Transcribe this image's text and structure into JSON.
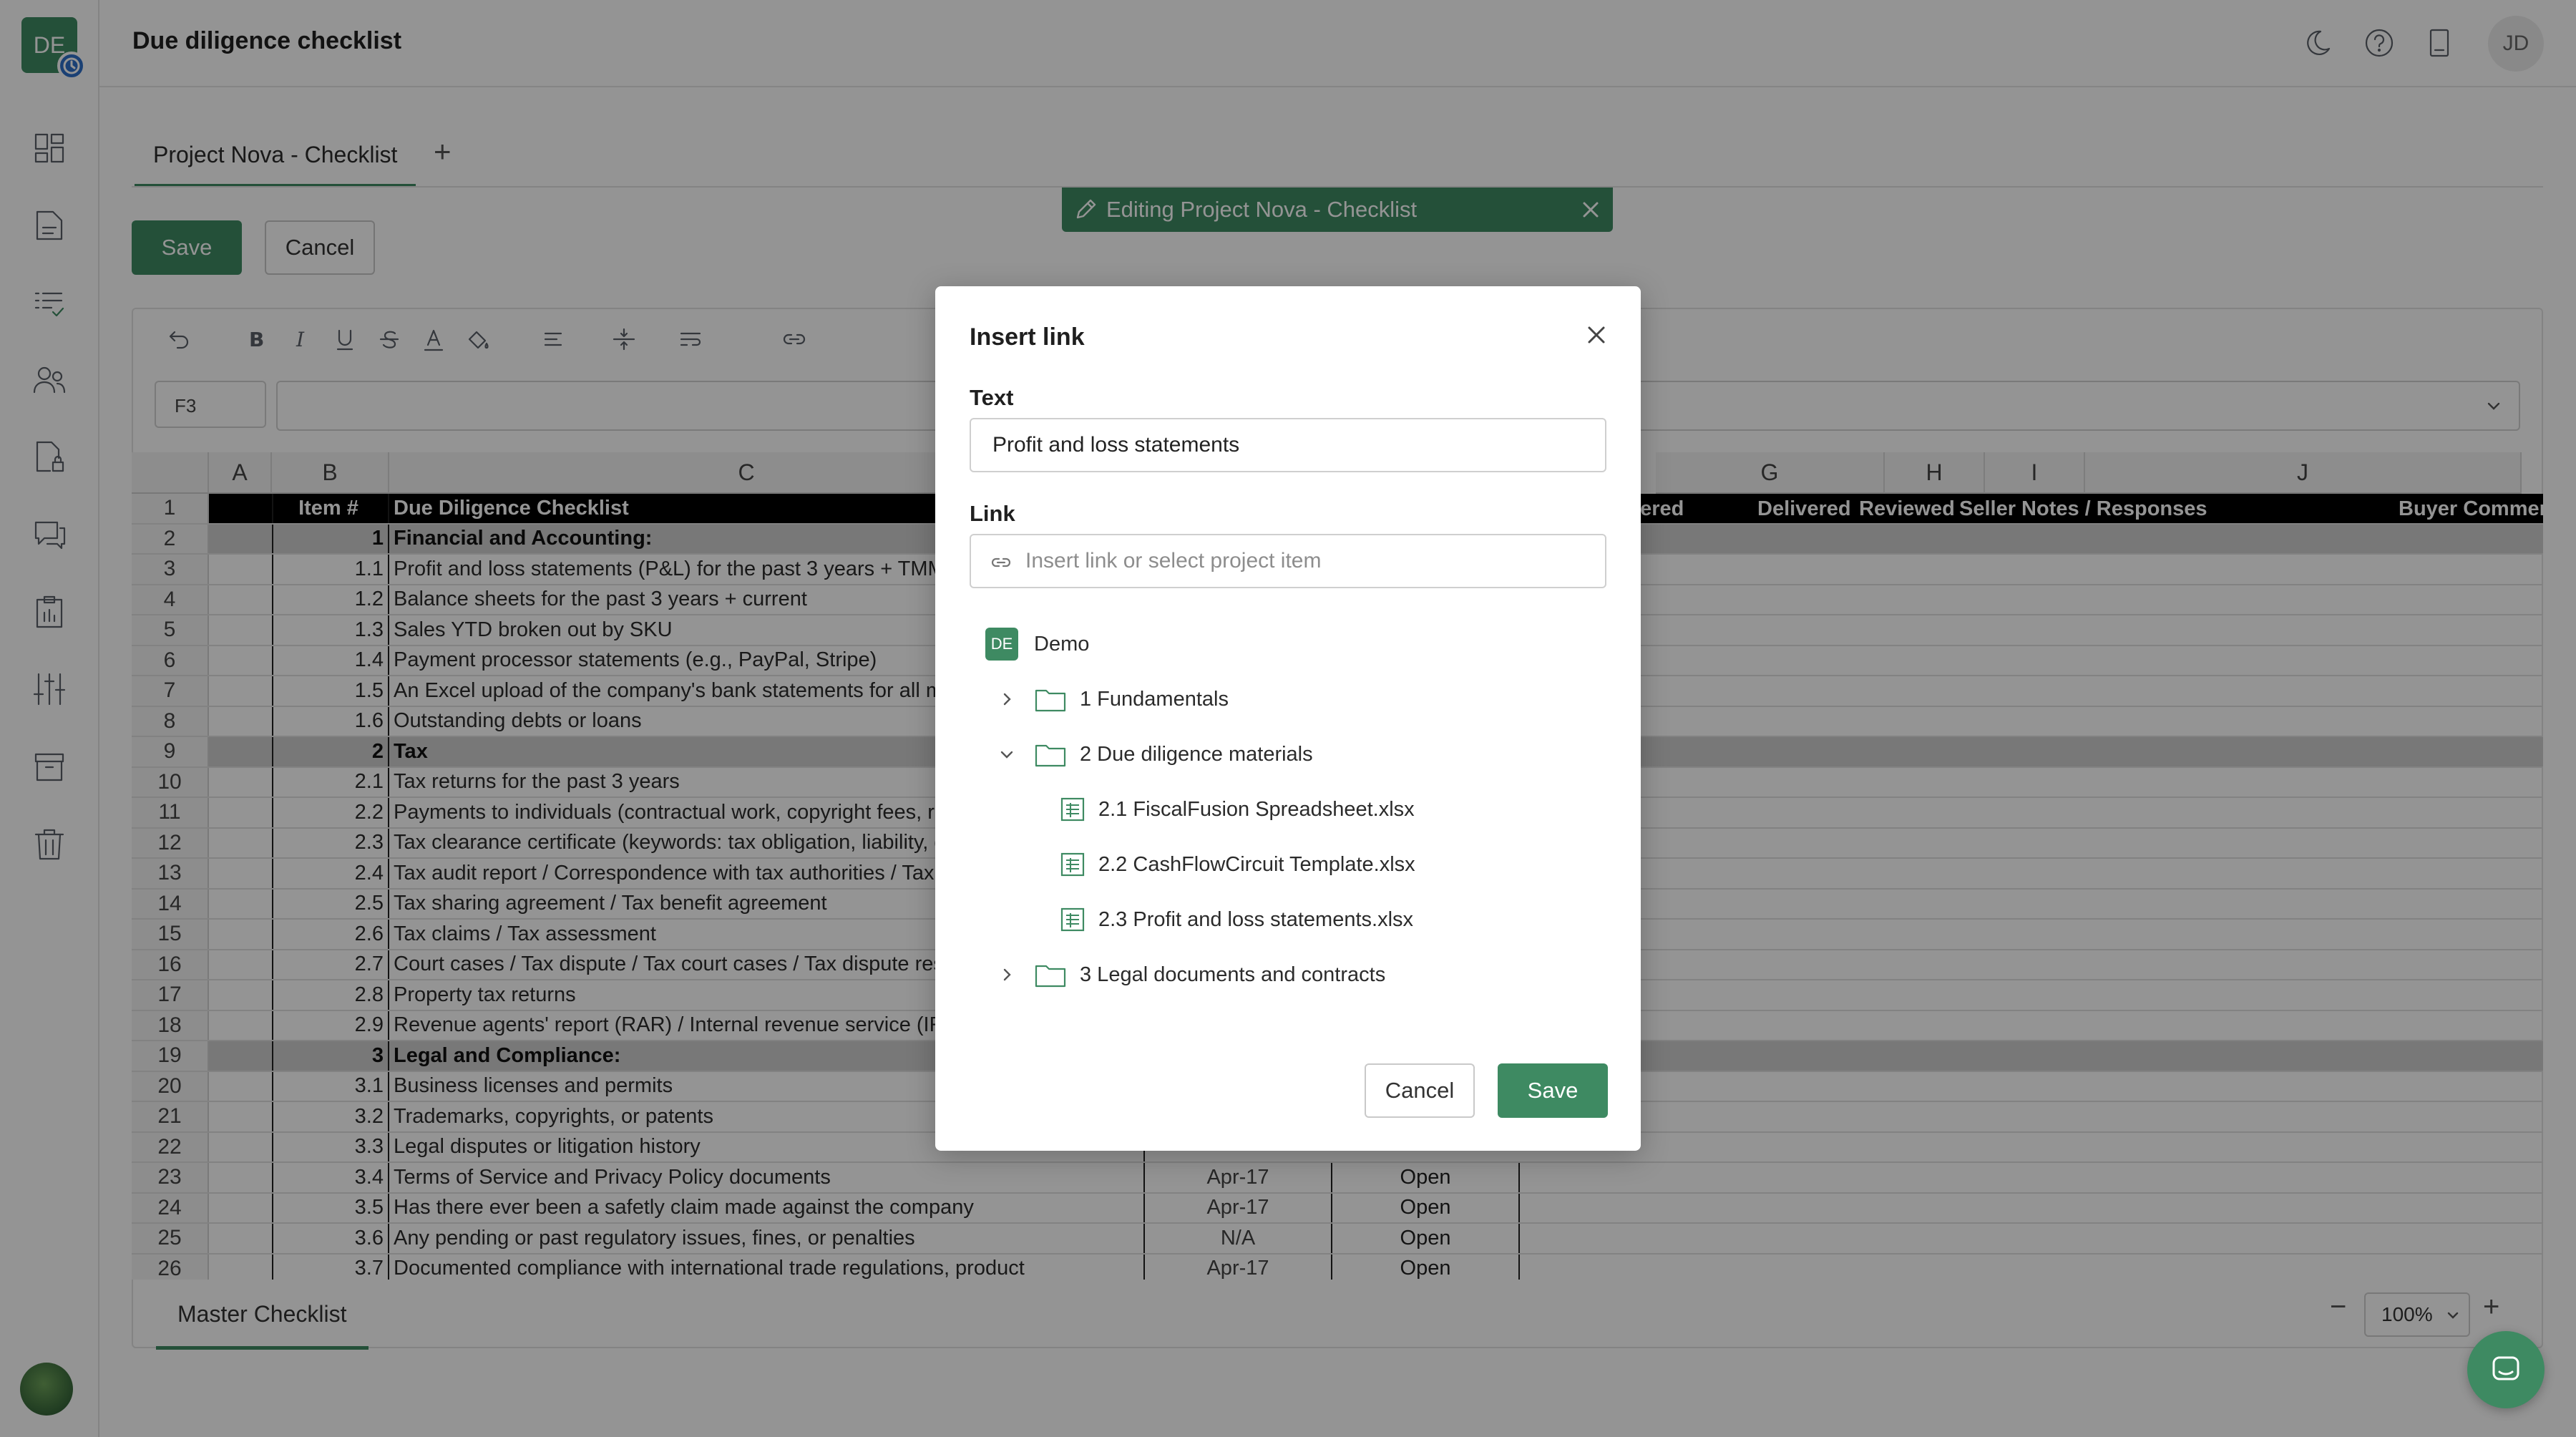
{
  "app": {
    "logo_text": "DE",
    "page_title": "Due diligence checklist",
    "avatar_initials": "JD"
  },
  "tabs": [
    {
      "label": "Project Nova - Checklist"
    }
  ],
  "actions": {
    "save_label": "Save",
    "cancel_label": "Cancel"
  },
  "editing_banner": "Editing Project Nova - Checklist",
  "sheet": {
    "cell_ref": "F3",
    "columns": [
      "A",
      "B",
      "C",
      "G",
      "H",
      "I",
      "J"
    ],
    "header_row": {
      "B": "Item #",
      "C": "Due Diligence Checklist",
      "right": [
        "vered",
        "Delivered",
        "Reviewed",
        "Seller Notes / Responses",
        "Buyer Commen"
      ]
    },
    "rows": [
      {
        "n": "2",
        "b": "1",
        "c": "Financial and Accounting:",
        "section": true
      },
      {
        "n": "3",
        "b": "1.1",
        "c": "Profit and loss statements (P&L) for the past 3 years + TMM"
      },
      {
        "n": "4",
        "b": "1.2",
        "c": "Balance sheets for the past 3 years + current"
      },
      {
        "n": "5",
        "b": "1.3",
        "c": "Sales YTD broken out by SKU"
      },
      {
        "n": "6",
        "b": "1.4",
        "c": "Payment processor statements (e.g., PayPal, Stripe)"
      },
      {
        "n": "7",
        "b": "1.5",
        "c": "An Excel upload of the company's bank statements for all m"
      },
      {
        "n": "8",
        "b": "1.6",
        "c": "Outstanding debts or loans"
      },
      {
        "n": "9",
        "b": "2",
        "c": "Tax",
        "section": true
      },
      {
        "n": "10",
        "b": "2.1",
        "c": "Tax returns for the past 3 years"
      },
      {
        "n": "11",
        "b": "2.2",
        "c": "Payments to individuals (contractual work, copyright fees, re"
      },
      {
        "n": "12",
        "b": "2.3",
        "c": "Tax clearance certificate (keywords: tax obligation, liability, d"
      },
      {
        "n": "13",
        "b": "2.4",
        "c": "Tax audit report / Correspondence with tax authorities / Tax r"
      },
      {
        "n": "14",
        "b": "2.5",
        "c": "Tax sharing agreement / Tax benefit agreement"
      },
      {
        "n": "15",
        "b": "2.6",
        "c": "Tax claims / Tax assessment"
      },
      {
        "n": "16",
        "b": "2.7",
        "c": "Court cases / Tax dispute / Tax court cases / Tax dispute res"
      },
      {
        "n": "17",
        "b": "2.8",
        "c": "Property tax returns"
      },
      {
        "n": "18",
        "b": "2.9",
        "c": "Revenue agents' report (RAR) / Internal revenue service (IR"
      },
      {
        "n": "19",
        "b": "3",
        "c": "Legal and Compliance:",
        "section": true
      },
      {
        "n": "20",
        "b": "3.1",
        "c": "Business licenses and permits"
      },
      {
        "n": "21",
        "b": "3.2",
        "c": "Trademarks, copyrights, or patents"
      },
      {
        "n": "22",
        "b": "3.3",
        "c": "Legal disputes or litigation history"
      },
      {
        "n": "23",
        "b": "3.4",
        "c": "Terms of Service and Privacy Policy documents",
        "d": "Apr-17",
        "e": "Open"
      },
      {
        "n": "24",
        "b": "3.5",
        "c": "Has there ever been a safetly claim made against the company",
        "d": "Apr-17",
        "e": "Open"
      },
      {
        "n": "25",
        "b": "3.6",
        "c": "Any pending or past regulatory issues, fines, or penalties",
        "d": "N/A",
        "e": "Open"
      },
      {
        "n": "26",
        "b": "3.7",
        "c": "Documented compliance with international trade regulations, product",
        "d": "Apr-17",
        "e": "Open"
      }
    ],
    "sheet_tab": "Master Checklist",
    "zoom": "100%"
  },
  "modal": {
    "title": "Insert link",
    "text_label": "Text",
    "text_value": "Profit and loss statements",
    "link_label": "Link",
    "link_placeholder": "Insert link or select project item",
    "tree": {
      "root_badge": "DE",
      "root": "Demo",
      "items": [
        {
          "label": "1 Fundamentals",
          "kind": "folder",
          "expanded": false
        },
        {
          "label": "2 Due diligence materials",
          "kind": "folder",
          "expanded": true
        },
        {
          "label": "2.1 FiscalFusion Spreadsheet.xlsx",
          "kind": "file"
        },
        {
          "label": "2.2 CashFlowCircuit Template.xlsx",
          "kind": "file"
        },
        {
          "label": "2.3 Profit and loss statements.xlsx",
          "kind": "file"
        },
        {
          "label": "3 Legal documents and contracts",
          "kind": "folder",
          "expanded": false
        }
      ]
    },
    "cancel_label": "Cancel",
    "save_label": "Save"
  },
  "colors": {
    "accent": "#3e8a62",
    "overlay": "rgba(0,0,0,0.42)"
  }
}
